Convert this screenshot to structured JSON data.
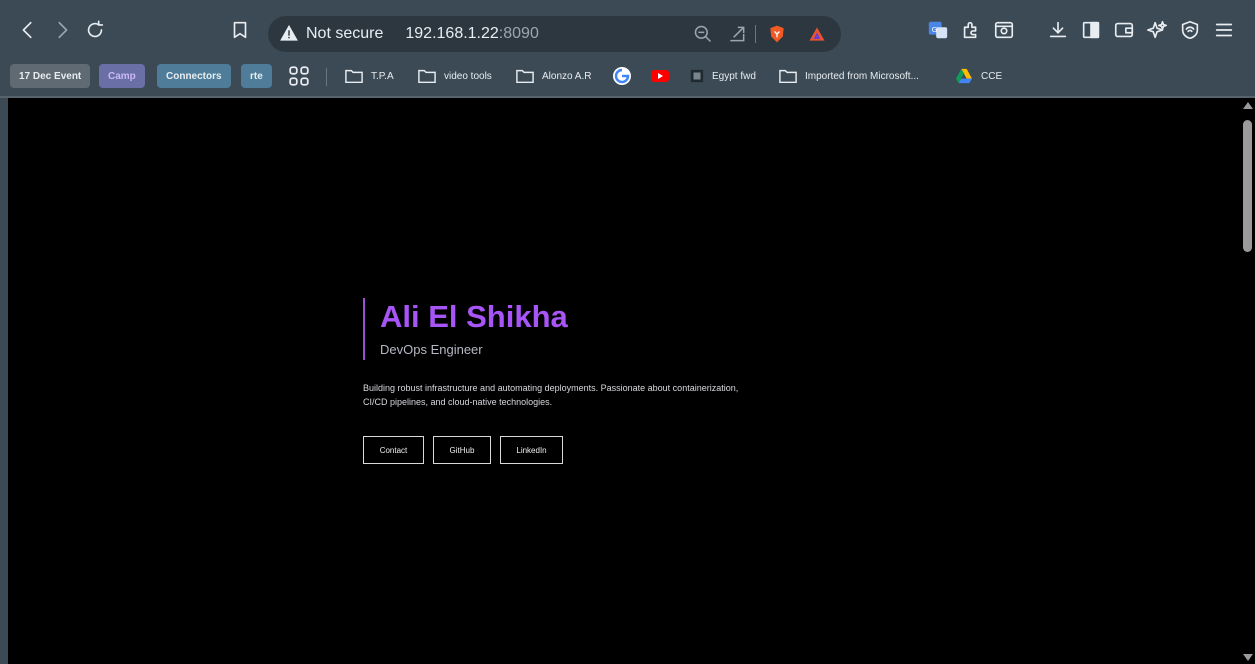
{
  "browser": {
    "security_label": "Not secure",
    "url_host": "192.168.1.22",
    "url_port": ":8090",
    "toolbar_icons": [
      "back-icon",
      "forward-icon",
      "reload-icon",
      "bookmark-icon",
      "zoom-icon",
      "share-icon",
      "brave-shields-icon",
      "brave-rewards-icon",
      "translate-icon",
      "extensions-icon",
      "reader-mode-icon",
      "downloads-icon",
      "sidebar-icon",
      "wallet-icon",
      "leo-icon",
      "vpn-icon",
      "menu-icon"
    ],
    "bookmarks": [
      {
        "label": "17 Dec Event",
        "kind": "pill",
        "color": "#5f6a72"
      },
      {
        "label": "Camp",
        "kind": "pill",
        "color": "#6a6fa6"
      },
      {
        "label": "Connectors",
        "kind": "pill",
        "color": "#4f7d99"
      },
      {
        "label": "rte",
        "kind": "pill",
        "color": "#4f7d99"
      },
      {
        "label": "",
        "kind": "apps"
      },
      {
        "label": "T.P.A",
        "kind": "folder"
      },
      {
        "label": "video tools",
        "kind": "folder"
      },
      {
        "label": "Alonzo A.R",
        "kind": "folder"
      },
      {
        "label": "",
        "kind": "google"
      },
      {
        "label": "",
        "kind": "youtube"
      },
      {
        "label": "Egypt fwd",
        "kind": "site"
      },
      {
        "label": "Imported from Microsoft...",
        "kind": "folder"
      },
      {
        "label": "CCE",
        "kind": "drive"
      }
    ]
  },
  "hero": {
    "name": "Ali El Shikha",
    "role": "DevOps Engineer",
    "bio": "Building robust infrastructure and automating deployments. Passionate about containerization, CI/CD pipelines, and cloud-native technologies.",
    "buttons": [
      "Contact",
      "GitHub",
      "LinkedIn"
    ],
    "accent_color": "#a855f7"
  }
}
